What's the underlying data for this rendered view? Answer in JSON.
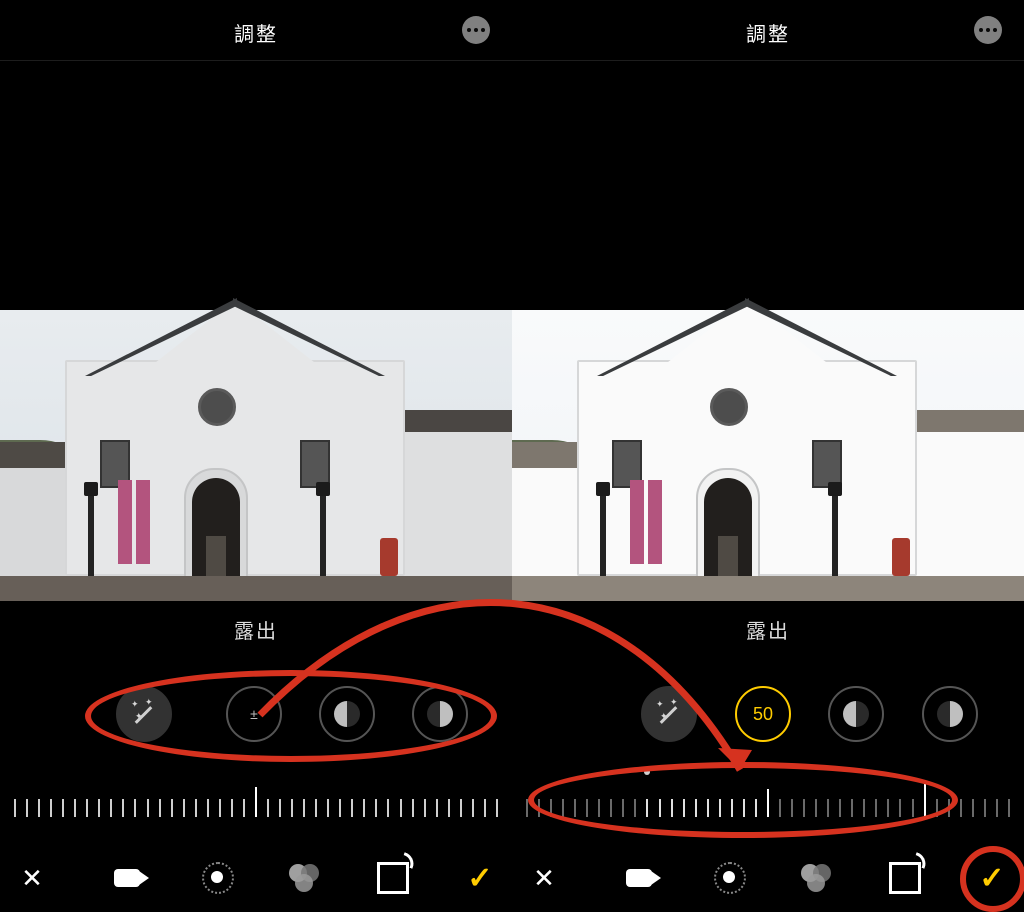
{
  "header": {
    "title": "調整"
  },
  "parameter": {
    "label": "露出"
  },
  "adjust_icons": {
    "auto": "auto-enhance-icon",
    "exposure": "exposure-icon",
    "brilliance": "brilliance-icon",
    "highlights": "highlights-icon"
  },
  "left": {
    "slider_value": 0,
    "exposure_value_display": "±"
  },
  "right": {
    "slider_value": 50,
    "exposure_value_display": "50"
  },
  "bottom_actions": {
    "cancel": "cancel",
    "video": "video",
    "adjust": "adjust",
    "filters": "filters",
    "crop": "crop",
    "done": "done"
  },
  "colors": {
    "accent": "#ffcc00",
    "annotation": "#d6321f"
  }
}
